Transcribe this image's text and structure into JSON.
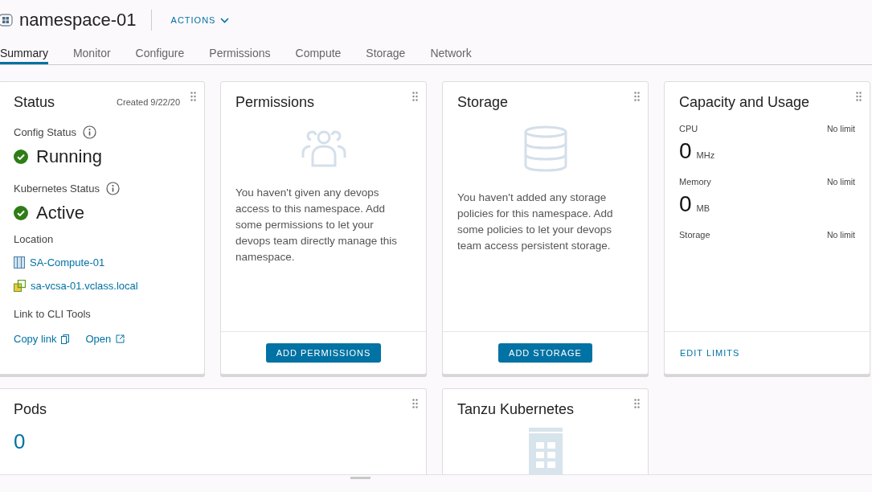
{
  "header": {
    "title": "namespace-01",
    "actions": "ACTIONS"
  },
  "tabs": [
    {
      "label": "Summary",
      "selected": true
    },
    {
      "label": "Monitor",
      "selected": false
    },
    {
      "label": "Configure",
      "selected": false
    },
    {
      "label": "Permissions",
      "selected": false
    },
    {
      "label": "Compute",
      "selected": false
    },
    {
      "label": "Storage",
      "selected": false
    },
    {
      "label": "Network",
      "selected": false
    }
  ],
  "status": {
    "title": "Status",
    "created": "Created 9/22/20",
    "statuses": [
      {
        "label": "Config Status",
        "value": "Running"
      },
      {
        "label": "Kubernetes Status",
        "value": "Active"
      }
    ],
    "location_label": "Location",
    "locations": [
      {
        "kind": "cluster",
        "name": "SA-Compute-01"
      },
      {
        "kind": "vcenter",
        "name": "sa-vcsa-01.vclass.local"
      }
    ],
    "cli_label": "Link to CLI Tools",
    "copy_link": "Copy link",
    "open": "Open"
  },
  "permissions": {
    "title": "Permissions",
    "text": "You haven't given any devops access to this namespace. Add some permissions to let your devops team directly manage this namespace.",
    "button": "ADD PERMISSIONS"
  },
  "storage": {
    "title": "Storage",
    "text": "You haven't added any storage policies for this namespace. Add some policies to let your devops team access persistent storage.",
    "button": "ADD STORAGE"
  },
  "capacity": {
    "title": "Capacity and Usage",
    "items": [
      {
        "label": "CPU",
        "limit": "No limit",
        "value": "0",
        "unit": "MHz"
      },
      {
        "label": "Memory",
        "limit": "No limit",
        "value": "0",
        "unit": "MB"
      },
      {
        "label": "Storage",
        "limit": "No limit"
      }
    ],
    "action": "EDIT LIMITS"
  },
  "pods": {
    "title": "Pods",
    "count": "0"
  },
  "tanzu": {
    "title": "Tanzu Kubernetes"
  }
}
